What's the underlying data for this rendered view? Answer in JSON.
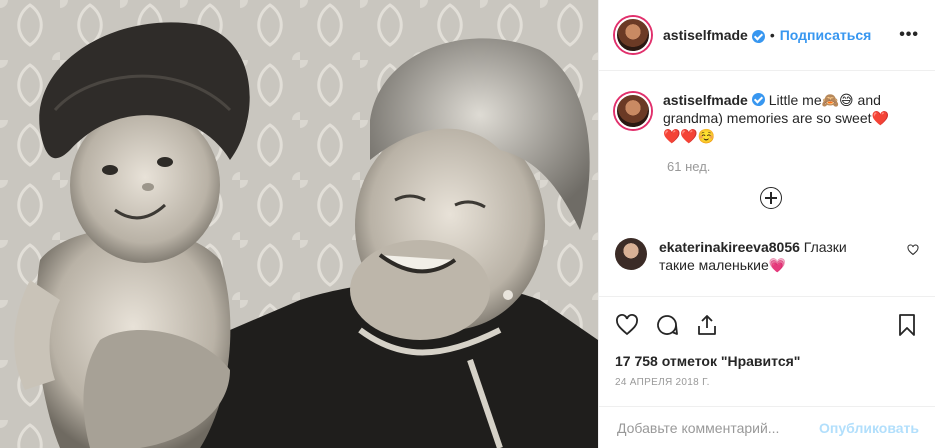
{
  "post": {
    "photo_icon": "vintage-photo-baby-and-grandmother",
    "header": {
      "username": "astiselfmade",
      "verified": true,
      "separator": "•",
      "follow_label": "Подписаться",
      "more_label": "•••"
    },
    "caption": {
      "username": "astiselfmade",
      "text": "Little me🙈😅 and grandma) memories are so sweet❤️❤️❤️☺️"
    },
    "time_ago": "61 нед.",
    "load_more_icon": "plus-circle-icon",
    "comments": [
      {
        "username": "ekaterinakireeva8056",
        "text": "Глазки такие маленькие💗"
      }
    ],
    "actions": {
      "like_icon": "heart-icon",
      "comment_icon": "comment-icon",
      "share_icon": "share-icon",
      "save_icon": "bookmark-icon"
    },
    "likes_text": "17 758 отметок \"Нравится\"",
    "date_text": "24 АПРЕЛЯ 2018 Г.",
    "add_comment": {
      "placeholder": "Добавьте комментарий...",
      "post_label": "Опубликовать"
    },
    "colors": {
      "accent": "#3897f0",
      "muted": "#999999",
      "border": "#efefef",
      "post_disabled": "#b2dffc",
      "heart": "#e0245e"
    }
  }
}
